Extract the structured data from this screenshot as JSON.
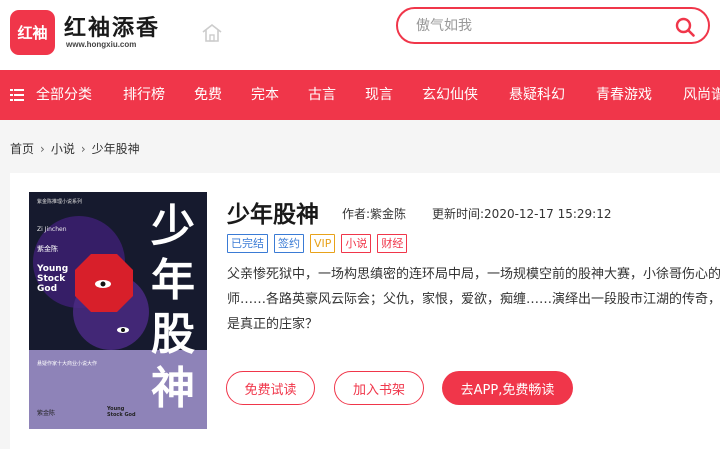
{
  "header": {
    "logo_text": "红袖",
    "brand_name": "红袖添香",
    "brand_url": "www.hongxiu.com",
    "search_placeholder": "傲气如我"
  },
  "nav": {
    "items": [
      {
        "label": "全部分类"
      },
      {
        "label": "排行榜"
      },
      {
        "label": "免费"
      },
      {
        "label": "完本"
      },
      {
        "label": "古言"
      },
      {
        "label": "现言"
      },
      {
        "label": "玄幻仙侠"
      },
      {
        "label": "悬疑科幻"
      },
      {
        "label": "青春游戏"
      },
      {
        "label": "风尚谱"
      }
    ]
  },
  "breadcrumb": [
    "首页",
    "小说",
    "少年股神"
  ],
  "book": {
    "title": "少年股神",
    "author": "作者:紫金陈",
    "update": "更新时间:2020-12-17 15:29:12",
    "tags": [
      {
        "label": "已完结",
        "color": "#3a7bd5"
      },
      {
        "label": "签约",
        "color": "#3a7bd5"
      },
      {
        "label": "VIP",
        "color": "#e8a21a"
      },
      {
        "label": "小说",
        "color": "#f0364a"
      },
      {
        "label": "财经",
        "color": "#f0364a"
      }
    ],
    "description": "父亲惨死狱中，一场构思缜密的连环局中局，一场规模空前的股神大赛，小徐哥伤心的师……各路英豪风云际会；父仇，家恨，爱欲，痴缠……演绎出一段股市江湖的传奇，谁才是真正的庄家？",
    "buttons": {
      "free_read": "免费试读",
      "add_shelf": "加入书架",
      "app_read": "去APP,免费畅读"
    }
  },
  "cover": {
    "series": "紫金陈推理小说系列",
    "title_cn": "少年股神",
    "en_line1": "Young",
    "en_line2": "Stock",
    "en_line3": "God",
    "author_en": "Zi Jinchen",
    "author_cn": "紫金陈",
    "tagline": "悬疑作家十大商业小说大作",
    "author_bottom": "紫金陈",
    "logo_bottom": "Young Stock God"
  },
  "colors": {
    "brand": "#f0364a"
  }
}
